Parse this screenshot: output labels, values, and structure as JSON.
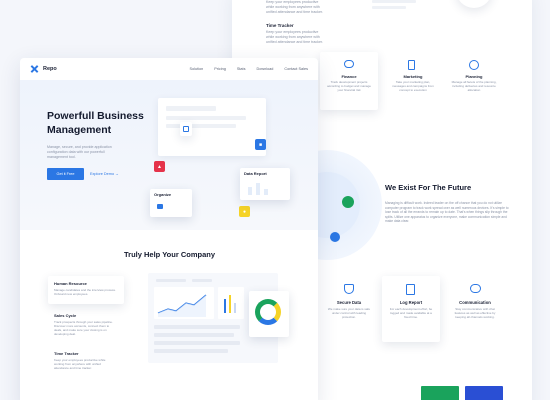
{
  "back": {
    "top_feature": {
      "title": "",
      "desc": "Keep your employees productive while working from anywhere with unified attendance and time tracker."
    },
    "time_tracker": {
      "title": "Time Tracker",
      "desc": "Keep your employees productive while working from anywhere with unified attendance and time tracker."
    },
    "icons_row": [
      {
        "title": "Finance",
        "desc": "Track development projects according to budget and manage your financial risk",
        "icon": "piggy-icon"
      },
      {
        "title": "Marketing",
        "desc": "Take your marketing plan, messages and campaigns from concept to execution",
        "icon": "phone-chart-icon"
      },
      {
        "title": "Planning",
        "desc": "Manage all facets of the planning, including deliveries and resource allocation",
        "icon": "target-icon"
      }
    ],
    "future": {
      "title": "We Exist For The Future",
      "desc": "Managing is difficult work. Indeed leader on the off chance that you do not utilize computer program to track work spread over as well numerous devices. It's simple to lose track of all the errands to remain up to date. That's when things slip through the splits. Utilize one apparatus to organize everyone, make communication simple and make data clear."
    },
    "bottom_row": [
      {
        "title": "Secure Data",
        "desc": "We make sure your data is safe under control with leading protection.",
        "icon": "shield-icon"
      },
      {
        "title": "Log Report",
        "desc": "For each development effort, be logged and made available at a fixed time.",
        "icon": "report-icon"
      },
      {
        "title": "Communication",
        "desc": "Stay communicative with chat features as well as effective by keeping all channels working.",
        "icon": "chat-icon"
      }
    ]
  },
  "front": {
    "brand": "Repo",
    "nav": [
      "Solution",
      "Pricing",
      "Stats",
      "Download",
      "Contact Sales"
    ],
    "hero_title": "Powerfull Business Management",
    "hero_desc": "Manage, secure, and provide application configuration data with our powerfull management tool.",
    "cta_primary": "Get it Free",
    "cta_secondary": "Explore Demo",
    "cta_secondary_arrow": "→",
    "card_organize": "Organize",
    "card_data_report": "Data Report",
    "section_title": "Truly Help Your Company",
    "features": [
      {
        "title": "Human Resource",
        "desc": "Manage candidates and the interview process. Onboard new employees."
      },
      {
        "title": "Sales Cycle",
        "desc": "Track prospects through your sales pipeline. Discover more accounts, connect them to deals, and make sure your closing is on developing deal."
      },
      {
        "title": "Time Tracker",
        "desc": "Keep your employees productive while working from anywhere with unified attendance and time tracker."
      }
    ]
  },
  "colors": {
    "primary": "#2b77e4",
    "green": "#1aa35c",
    "red": "#e5334a",
    "yellow": "#f5d327",
    "dark_blue": "#2a4fd4"
  }
}
